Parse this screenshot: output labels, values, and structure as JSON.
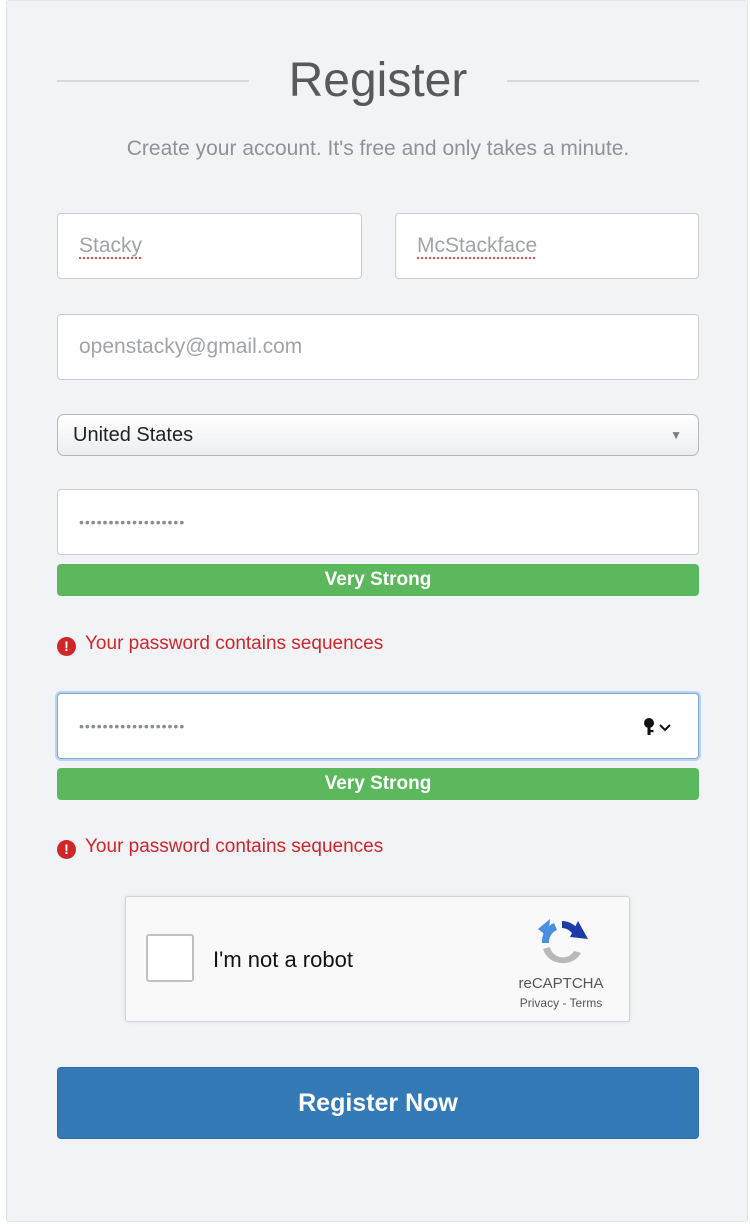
{
  "header": {
    "title": "Register",
    "subtitle": "Create your account. It's free and only takes a minute."
  },
  "form": {
    "first_name": "Stacky",
    "last_name": "McStackface",
    "email_placeholder": "openstacky@gmail.com",
    "country": "United States",
    "password_mask": "••••••••••••••••••",
    "confirm_password_mask": "••••••••••••••••••",
    "password_strength": "Very Strong",
    "confirm_strength": "Very Strong",
    "password_error": "Your password contains sequences",
    "confirm_error": "Your password contains sequences",
    "error_icon": "!",
    "strength_color": "#5cb85c",
    "error_color": "#d0262a"
  },
  "captcha": {
    "label": "I'm not a robot",
    "brand": "reCAPTCHA",
    "links": "Privacy - Terms"
  },
  "actions": {
    "register_label": "Register Now",
    "button_color": "#337ab7"
  }
}
